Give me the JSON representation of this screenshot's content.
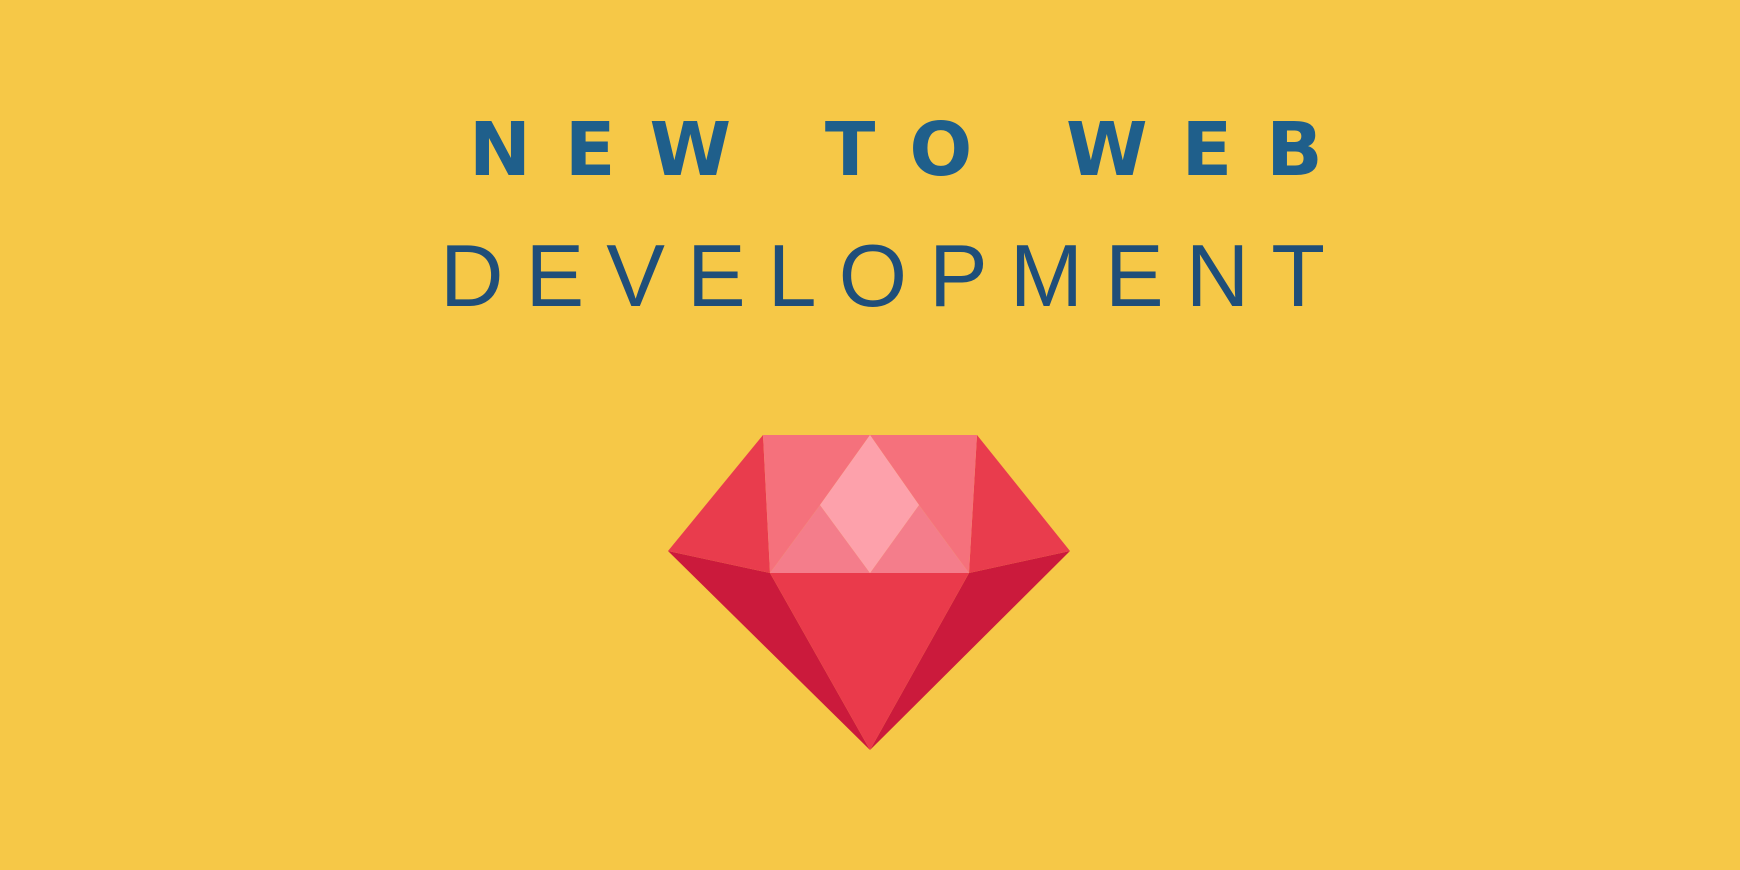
{
  "banner": {
    "headline": "NEW TO WEB",
    "subheadline": "DEVELOPMENT",
    "background_color": "#f6c847",
    "headline_color": "#1f5f8b",
    "subheadline_color": "#1f4e79"
  },
  "gem": {
    "icon": "ruby-gem-icon",
    "colors": {
      "top_light": "#fda1ab",
      "top_mid": "#f5717c",
      "top_soft": "#f47d8b",
      "crown_side": "#e93c4d",
      "pavilion_center": "#ea3a4b",
      "pavilion_dark": "#cb1a3c"
    }
  }
}
